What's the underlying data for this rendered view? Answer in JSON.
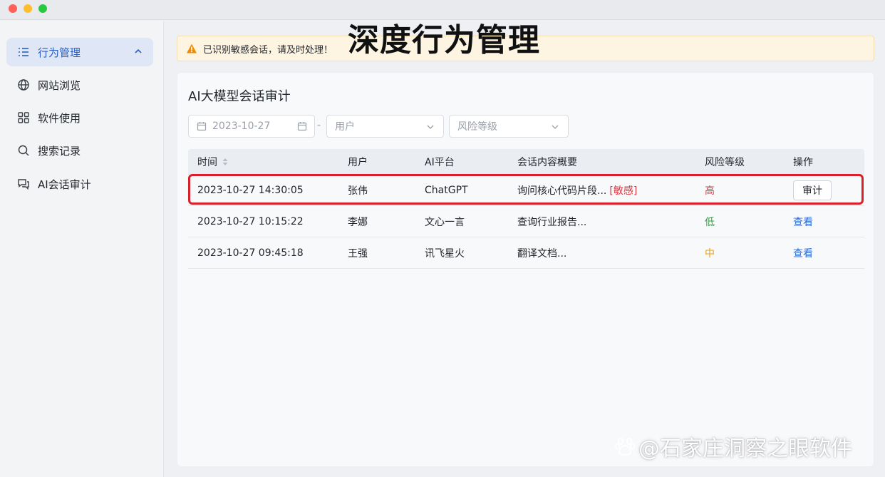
{
  "sidebar": {
    "items": [
      {
        "label": "行为管理",
        "icon": "list-icon",
        "active": true
      },
      {
        "label": "网站浏览",
        "icon": "globe-icon"
      },
      {
        "label": "软件使用",
        "icon": "apps-grid-icon"
      },
      {
        "label": "搜索记录",
        "icon": "search-icon"
      },
      {
        "label": "AI会话审计",
        "icon": "chat-bubbles-icon"
      }
    ]
  },
  "banner": {
    "text": "已识别敏感会话，请及时处理！",
    "overlay_title": "深度行为管理"
  },
  "card": {
    "title": "AI大模型会话审计",
    "filters": {
      "date": "2023-10-27",
      "separator": "-",
      "user_placeholder": "用户",
      "risk_placeholder": "风险等级"
    }
  },
  "table": {
    "headers": [
      "时间",
      "用户",
      "AI平台",
      "会话内容概要",
      "风险等级",
      "操作"
    ],
    "rows": [
      {
        "time": "2023-10-27 14:30:05",
        "user": "张伟",
        "platform": "ChatGPT",
        "summary": "询问核心代码片段...",
        "tag": "[敏感]",
        "risk": "高",
        "action": "审计"
      },
      {
        "time": "2023-10-27 10:15:22",
        "user": "李娜",
        "platform": "文心一言",
        "summary": "查询行业报告...",
        "tag": "",
        "risk": "低",
        "action": "查看"
      },
      {
        "time": "2023-10-27 09:45:18",
        "user": "王强",
        "platform": "讯飞星火",
        "summary": "翻译文档...",
        "tag": "",
        "risk": "中",
        "action": "查看"
      }
    ]
  },
  "watermark": "@石家庄洞察之眼软件",
  "colors": {
    "accent": "#2b5fc4",
    "danger": "#d9363e",
    "success": "#3a9a48",
    "warning": "#e8a21a",
    "banner_bg": "#fdf4e1"
  }
}
